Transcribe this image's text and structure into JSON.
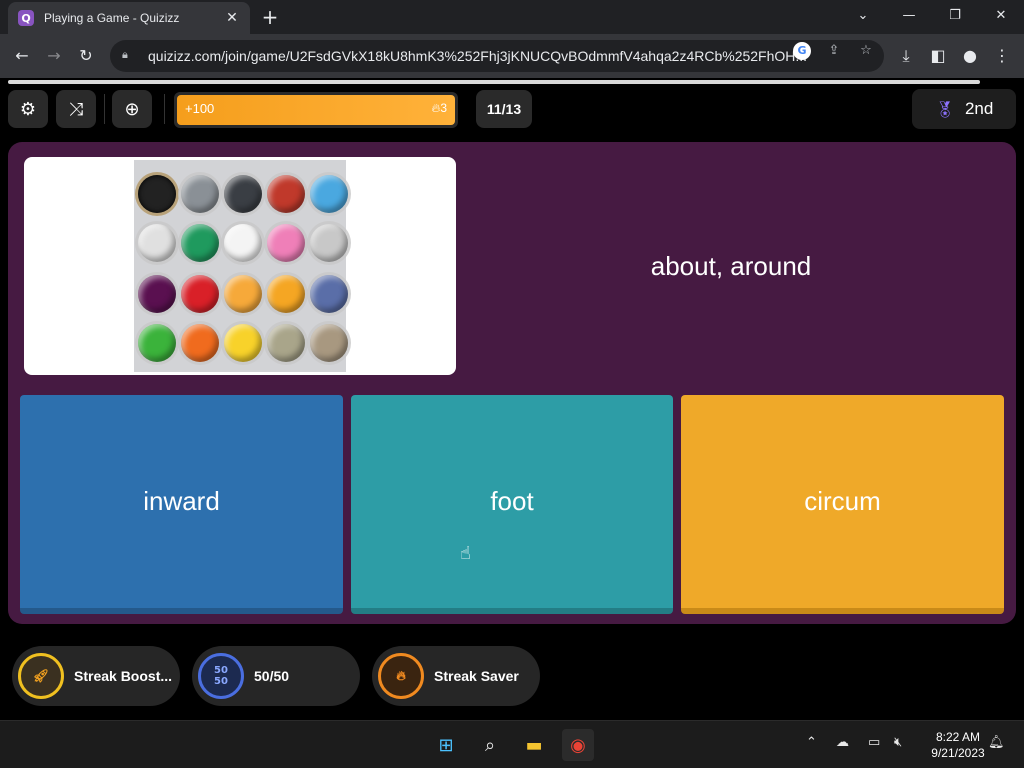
{
  "browser": {
    "tab_title": "Playing a Game - Quizizz",
    "tab_favicon": "Q",
    "tab_close": "✕",
    "new_tab": "+",
    "url": "quizizz.com/join/game/U2FsdGVkX18kU8hmK3%252Fhj3jKNUCQvBOdmmfV4ahqa2z4RCb%252FhOH..."
  },
  "hud": {
    "score_gain": "+100",
    "streak": "3",
    "question_counter": "11/13",
    "rank": "2nd"
  },
  "question": {
    "text": "about, around"
  },
  "options": [
    {
      "label": "inward",
      "color": "#2d70ae"
    },
    {
      "label": "foot",
      "color": "#2d9da6"
    },
    {
      "label": "circum",
      "color": "#efa929"
    }
  ],
  "powerups": [
    {
      "label": "Streak Boost...",
      "icon": "rocket-icon"
    },
    {
      "label": "50/50",
      "icon": "fifty-fifty-icon",
      "badge": "50\n50"
    },
    {
      "label": "Streak Saver",
      "icon": "flame-icon"
    }
  ],
  "clock": {
    "time": "8:22 AM",
    "date": "9/21/2023"
  },
  "colors": {
    "panel": "#461a42",
    "accent": "#f59e1c"
  }
}
